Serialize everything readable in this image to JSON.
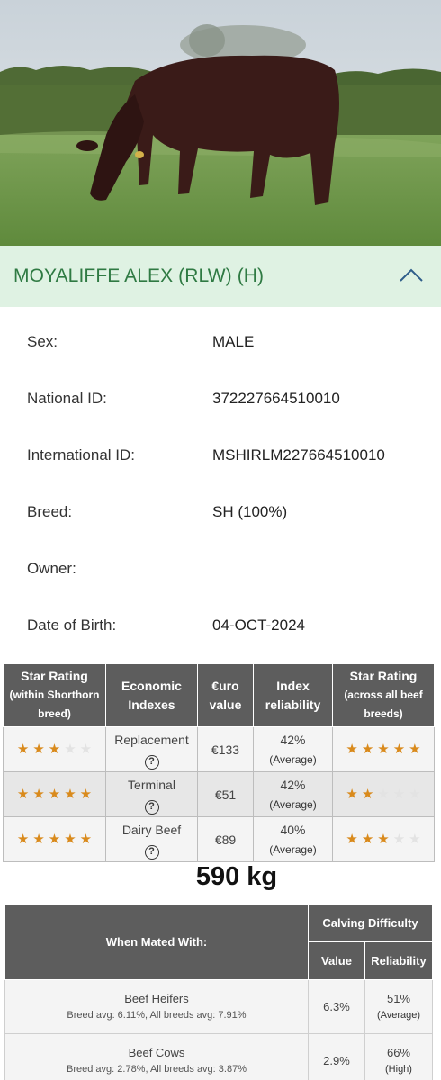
{
  "animal": {
    "name": "MOYALIFFE ALEX (RLW) (H)",
    "details": [
      {
        "label": "Sex:",
        "value": "MALE"
      },
      {
        "label": "National ID:",
        "value": "372227664510010"
      },
      {
        "label": "International ID:",
        "value": "MSHIRLM227664510010"
      },
      {
        "label": "Breed:",
        "value": "SH (100%)"
      },
      {
        "label": "Owner:",
        "value": ""
      },
      {
        "label": "Date of Birth:",
        "value": "04-OCT-2024"
      }
    ]
  },
  "index_table": {
    "headers": {
      "star_within_1": "Star Rating",
      "star_within_2": "(within Shorthorn",
      "star_within_3": "breed)",
      "economic_1": "Economic",
      "economic_2": "Indexes",
      "euro_1": "€uro",
      "euro_2": "value",
      "reliability_1": "Index",
      "reliability_2": "reliability",
      "star_across_1": "Star Rating",
      "star_across_2": "(across all beef",
      "star_across_3": "breeds)"
    },
    "rows": [
      {
        "index": "Replacement",
        "euro": "€133",
        "reliability": "42%",
        "reliability_level": "(Average)",
        "stars_within": 3,
        "stars_across": 5
      },
      {
        "index": "Terminal",
        "euro": "€51",
        "reliability": "42%",
        "reliability_level": "(Average)",
        "stars_within": 5,
        "stars_across": 2
      },
      {
        "index": "Dairy Beef",
        "euro": "€89",
        "reliability": "40%",
        "reliability_level": "(Average)",
        "stars_within": 5,
        "stars_across": 3
      }
    ],
    "help_icon_text": "?",
    "star_color_on": "#d98a1c",
    "star_color_off": "#e3e3e3"
  },
  "weight": "590 kg",
  "calving": {
    "headers": {
      "mated_with": "When Mated With:",
      "calving_difficulty": "Calving Difficulty",
      "value": "Value",
      "reliability": "Reliability"
    },
    "rows": [
      {
        "group": "Beef Heifers",
        "avg": "Breed avg: 6.11%, All breeds avg: 7.91%",
        "value": "6.3%",
        "reliability": "51%",
        "reliability_level": "(Average)"
      },
      {
        "group": "Beef Cows",
        "avg": "Breed avg: 2.78%, All breeds avg: 3.87%",
        "value": "2.9%",
        "reliability": "66%",
        "reliability_level": "(High)"
      }
    ]
  },
  "colors": {
    "header_bg": "#dff2e3",
    "header_text": "#2f7a43",
    "table_header_bg": "#5d5d5d"
  }
}
